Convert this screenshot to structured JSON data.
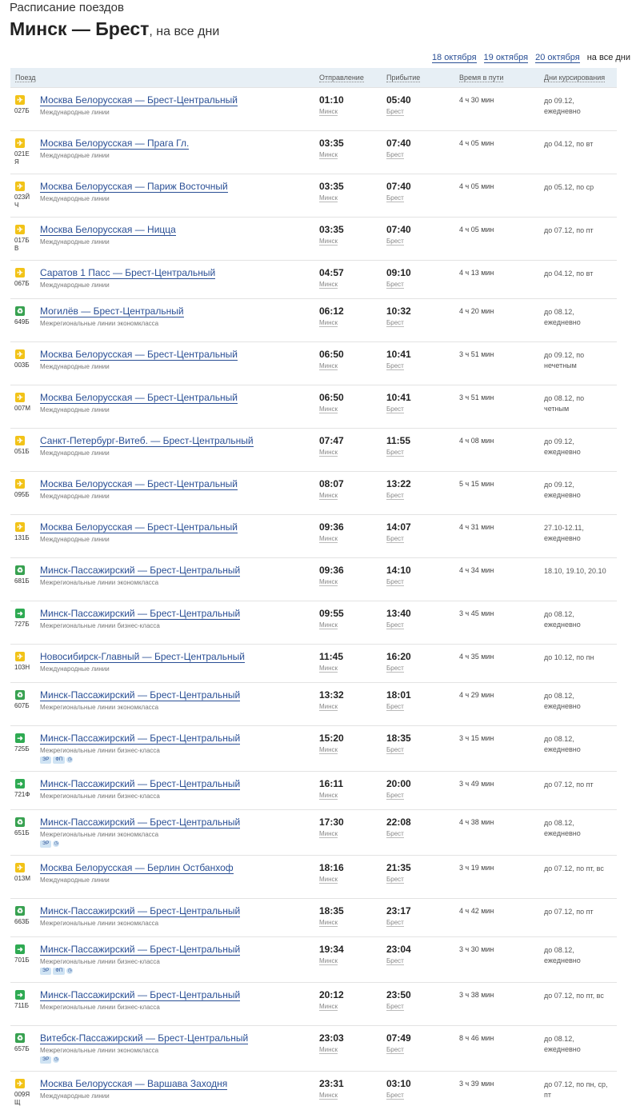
{
  "header": {
    "subtitle": "Расписание поездов",
    "title": "Минск — Брест",
    "title_suffix": ", на все дни"
  },
  "dates": [
    {
      "label": "18 октября",
      "link": true
    },
    {
      "label": "19 октября",
      "link": true
    },
    {
      "label": "20 октября",
      "link": true
    },
    {
      "label": "на все дни",
      "link": false
    }
  ],
  "columns": {
    "train": "Поезд",
    "departure": "Отправление",
    "arrival": "Прибытие",
    "duration": "Время в пути",
    "days": "Дни курсирования"
  },
  "trains": [
    {
      "icon": "intl",
      "number": "027Б",
      "route": "Москва Белорусская — Брест-Центральный",
      "type": "Международные линии",
      "badges": [],
      "clock": false,
      "dep": "01:10",
      "dep_st": "Минск",
      "arr": "05:40",
      "arr_st": "Брест",
      "dur": "4 ч 30 мин",
      "days": "до 09.12, ежедневно"
    },
    {
      "icon": "intl",
      "number": "021ЕЯ",
      "route": "Москва Белорусская — Прага Гл.",
      "type": "Международные линии",
      "badges": [],
      "clock": false,
      "dep": "03:35",
      "dep_st": "Минск",
      "arr": "07:40",
      "arr_st": "Брест",
      "dur": "4 ч 05 мин",
      "days": "до 04.12, по вт"
    },
    {
      "icon": "intl",
      "number": "023ЙЧ",
      "route": "Москва Белорусская — Париж Восточный",
      "type": "Международные линии",
      "badges": [],
      "clock": false,
      "dep": "03:35",
      "dep_st": "Минск",
      "arr": "07:40",
      "arr_st": "Брест",
      "dur": "4 ч 05 мин",
      "days": "до 05.12, по ср"
    },
    {
      "icon": "intl",
      "number": "017БВ",
      "route": "Москва Белорусская — Ницца",
      "type": "Международные линии",
      "badges": [],
      "clock": false,
      "dep": "03:35",
      "dep_st": "Минск",
      "arr": "07:40",
      "arr_st": "Брест",
      "dur": "4 ч 05 мин",
      "days": "до 07.12, по пт"
    },
    {
      "icon": "intl",
      "number": "067Б",
      "route": "Саратов 1 Пасс — Брест-Центральный",
      "type": "Международные линии",
      "badges": [],
      "clock": false,
      "dep": "04:57",
      "dep_st": "Минск",
      "arr": "09:10",
      "arr_st": "Брест",
      "dur": "4 ч 13 мин",
      "days": "до 04.12, по вт"
    },
    {
      "icon": "eco",
      "number": "649Б",
      "route": "Могилёв — Брест-Центральный",
      "type": "Межрегиональные линии экономкласса",
      "badges": [],
      "clock": false,
      "dep": "06:12",
      "dep_st": "Минск",
      "arr": "10:32",
      "arr_st": "Брест",
      "dur": "4 ч 20 мин",
      "days": "до 08.12, ежедневно"
    },
    {
      "icon": "intl",
      "number": "003Б",
      "route": "Москва Белорусская — Брест-Центральный",
      "type": "Международные линии",
      "badges": [],
      "clock": false,
      "dep": "06:50",
      "dep_st": "Минск",
      "arr": "10:41",
      "arr_st": "Брест",
      "dur": "3 ч 51 мин",
      "days": "до 09.12, по нечетным"
    },
    {
      "icon": "intl",
      "number": "007М",
      "route": "Москва Белорусская — Брест-Центральный",
      "type": "Международные линии",
      "badges": [],
      "clock": false,
      "dep": "06:50",
      "dep_st": "Минск",
      "arr": "10:41",
      "arr_st": "Брест",
      "dur": "3 ч 51 мин",
      "days": "до 08.12, по четным"
    },
    {
      "icon": "intl",
      "number": "051Б",
      "route": "Санкт-Петербург-Витеб. — Брест-Центральный",
      "type": "Международные линии",
      "badges": [],
      "clock": false,
      "dep": "07:47",
      "dep_st": "Минск",
      "arr": "11:55",
      "arr_st": "Брест",
      "dur": "4 ч 08 мин",
      "days": "до 09.12, ежедневно"
    },
    {
      "icon": "intl",
      "number": "095Б",
      "route": "Москва Белорусская — Брест-Центральный",
      "type": "Международные линии",
      "badges": [],
      "clock": false,
      "dep": "08:07",
      "dep_st": "Минск",
      "arr": "13:22",
      "arr_st": "Брест",
      "dur": "5 ч 15 мин",
      "days": "до 09.12, ежедневно"
    },
    {
      "icon": "intl",
      "number": "131Б",
      "route": "Москва Белорусская — Брест-Центральный",
      "type": "Международные линии",
      "badges": [],
      "clock": false,
      "dep": "09:36",
      "dep_st": "Минск",
      "arr": "14:07",
      "arr_st": "Брест",
      "dur": "4 ч 31 мин",
      "days": "27.10-12.11, ежедневно"
    },
    {
      "icon": "eco",
      "number": "681Б",
      "route": "Минск-Пассажирский — Брест-Центральный",
      "type": "Межрегиональные линии экономкласса",
      "badges": [],
      "clock": false,
      "dep": "09:36",
      "dep_st": "Минск",
      "arr": "14:10",
      "arr_st": "Брест",
      "dur": "4 ч 34 мин",
      "days": "18.10, 19.10, 20.10"
    },
    {
      "icon": "bus",
      "number": "727Б",
      "route": "Минск-Пассажирский — Брест-Центральный",
      "type": "Межрегиональные линии бизнес-класса",
      "badges": [],
      "clock": false,
      "dep": "09:55",
      "dep_st": "Минск",
      "arr": "13:40",
      "arr_st": "Брест",
      "dur": "3 ч 45 мин",
      "days": "до 08.12, ежедневно"
    },
    {
      "icon": "intl",
      "number": "103Н",
      "route": "Новосибирск-Главный — Брест-Центральный",
      "type": "Международные линии",
      "badges": [],
      "clock": false,
      "dep": "11:45",
      "dep_st": "Минск",
      "arr": "16:20",
      "arr_st": "Брест",
      "dur": "4 ч 35 мин",
      "days": "до 10.12, по пн"
    },
    {
      "icon": "eco",
      "number": "607Б",
      "route": "Минск-Пассажирский — Брест-Центральный",
      "type": "Межрегиональные линии экономкласса",
      "badges": [],
      "clock": false,
      "dep": "13:32",
      "dep_st": "Минск",
      "arr": "18:01",
      "arr_st": "Брест",
      "dur": "4 ч 29 мин",
      "days": "до 08.12, ежедневно"
    },
    {
      "icon": "bus",
      "number": "725Б",
      "route": "Минск-Пассажирский — Брест-Центральный",
      "type": "Межрегиональные линии бизнес-класса",
      "badges": [
        "ЭР",
        "ФП"
      ],
      "clock": true,
      "dep": "15:20",
      "dep_st": "Минск",
      "arr": "18:35",
      "arr_st": "Брест",
      "dur": "3 ч 15 мин",
      "days": "до 08.12, ежедневно"
    },
    {
      "icon": "bus",
      "number": "721Ф",
      "route": "Минск-Пассажирский — Брест-Центральный",
      "type": "Межрегиональные линии бизнес-класса",
      "badges": [],
      "clock": false,
      "dep": "16:11",
      "dep_st": "Минск",
      "arr": "20:00",
      "arr_st": "Брест",
      "dur": "3 ч 49 мин",
      "days": "до 07.12, по пт"
    },
    {
      "icon": "eco",
      "number": "651Б",
      "route": "Минск-Пассажирский — Брест-Центральный",
      "type": "Межрегиональные линии экономкласса",
      "badges": [
        "ЭР"
      ],
      "clock": true,
      "dep": "17:30",
      "dep_st": "Минск",
      "arr": "22:08",
      "arr_st": "Брест",
      "dur": "4 ч 38 мин",
      "days": "до 08.12, ежедневно"
    },
    {
      "icon": "intl",
      "number": "013М",
      "route": "Москва Белорусская — Берлин Остбанхоф",
      "type": "Международные линии",
      "badges": [],
      "clock": false,
      "dep": "18:16",
      "dep_st": "Минск",
      "arr": "21:35",
      "arr_st": "Брест",
      "dur": "3 ч 19 мин",
      "days": "до 07.12, по пт, вс"
    },
    {
      "icon": "eco",
      "number": "663Б",
      "route": "Минск-Пассажирский — Брест-Центральный",
      "type": "Межрегиональные линии экономкласса",
      "badges": [],
      "clock": false,
      "dep": "18:35",
      "dep_st": "Минск",
      "arr": "23:17",
      "arr_st": "Брест",
      "dur": "4 ч 42 мин",
      "days": "до 07.12, по пт"
    },
    {
      "icon": "bus",
      "number": "701Б",
      "route": "Минск-Пассажирский — Брест-Центральный",
      "type": "Межрегиональные линии бизнес-класса",
      "badges": [
        "ЭР",
        "ФП"
      ],
      "clock": true,
      "dep": "19:34",
      "dep_st": "Минск",
      "arr": "23:04",
      "arr_st": "Брест",
      "dur": "3 ч 30 мин",
      "days": "до 08.12, ежедневно"
    },
    {
      "icon": "bus",
      "number": "711Б",
      "route": "Минск-Пассажирский — Брест-Центральный",
      "type": "Межрегиональные линии бизнес-класса",
      "badges": [],
      "clock": false,
      "dep": "20:12",
      "dep_st": "Минск",
      "arr": "23:50",
      "arr_st": "Брест",
      "dur": "3 ч 38 мин",
      "days": "до 07.12, по пт, вс"
    },
    {
      "icon": "eco",
      "number": "657Б",
      "route": "Витебск-Пассажирский — Брест-Центральный",
      "type": "Межрегиональные линии экономкласса",
      "badges": [
        "ЭР"
      ],
      "clock": true,
      "dep": "23:03",
      "dep_st": "Минск",
      "arr": "07:49",
      "arr_st": "Брест",
      "dur": "8 ч 46 мин",
      "days": "до 08.12, ежедневно"
    },
    {
      "icon": "intl",
      "number": "009ЯЩ",
      "route": "Москва Белорусская — Варшава Заходня",
      "type": "Международные линии",
      "badges": [],
      "clock": false,
      "dep": "23:31",
      "dep_st": "Минск",
      "arr": "03:10",
      "arr_st": "Брест",
      "dur": "3 ч 39 мин",
      "days": "до 07.12, по пн, ср, пт"
    }
  ]
}
